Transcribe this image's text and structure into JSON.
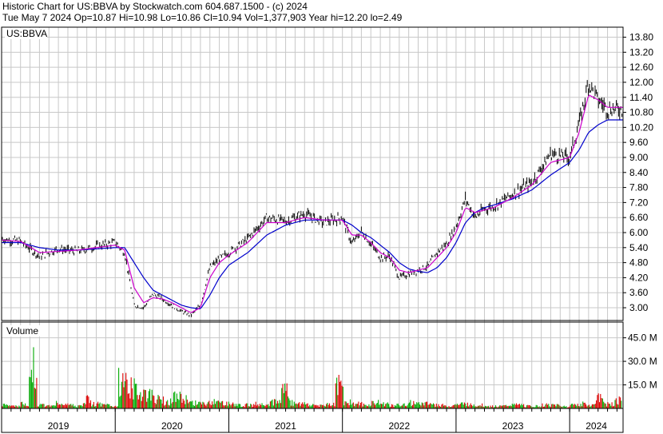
{
  "header": {
    "title_line": "Historic Chart for US:BBVA by Stockwatch.com 604.687.1500 - (c) 2024",
    "quote_line": "Tue May  7 2024  Op=10.87  Hi=10.98  Lo=10.86  Cl=10.94  Vol=1,377,903  Year hi=12.20  lo=2.49"
  },
  "colors": {
    "up": "#00aa00",
    "down": "#dd0000",
    "ma_short": "#cc00cc",
    "ma_long": "#0000cc",
    "grid": "#c8c8c8",
    "price_bars": "#000000"
  },
  "chart_data": [
    {
      "type": "line",
      "panel": "price",
      "label": "US:BBVA",
      "ylim": [
        2.49,
        14.2
      ],
      "yticks": [
        "3.00",
        "3.60",
        "4.20",
        "4.80",
        "5.40",
        "6.00",
        "6.60",
        "7.20",
        "7.80",
        "8.40",
        "9.00",
        "9.60",
        "10.20",
        "10.80",
        "11.40",
        "12.00",
        "12.60",
        "13.20",
        "13.80"
      ],
      "x": [
        "2019-01",
        "2019-03",
        "2019-05",
        "2019-07",
        "2019-09",
        "2019-11",
        "2020-01",
        "2020-02",
        "2020-03",
        "2020-04",
        "2020-05",
        "2020-06",
        "2020-07",
        "2020-08",
        "2020-09",
        "2020-10",
        "2020-11",
        "2020-12",
        "2021-01",
        "2021-03",
        "2021-05",
        "2021-07",
        "2021-09",
        "2021-11",
        "2022-01",
        "2022-02",
        "2022-03",
        "2022-04",
        "2022-05",
        "2022-06",
        "2022-07",
        "2022-08",
        "2022-09",
        "2022-10",
        "2022-11",
        "2022-12",
        "2023-01",
        "2023-02",
        "2023-03",
        "2023-04",
        "2023-05",
        "2023-07",
        "2023-09",
        "2023-11",
        "2024-01",
        "2024-02",
        "2024-03",
        "2024-04",
        "2024-05"
      ],
      "series": [
        {
          "name": "",
          "role": "close",
          "values": [
            5.75,
            5.65,
            5.05,
            5.35,
            5.25,
            5.45,
            5.6,
            5.2,
            3.1,
            3.0,
            3.55,
            3.35,
            3.1,
            2.85,
            2.7,
            3.1,
            4.6,
            4.95,
            5.2,
            5.75,
            6.6,
            6.45,
            6.75,
            6.4,
            6.6,
            5.55,
            6.05,
            5.55,
            5.0,
            5.05,
            4.2,
            4.35,
            4.5,
            4.65,
            5.2,
            5.55,
            6.25,
            7.35,
            6.6,
            6.95,
            7.05,
            7.55,
            8.0,
            9.15,
            9.0,
            10.35,
            12.0,
            11.3,
            10.94
          ]
        },
        {
          "name": "",
          "role": "ma-short",
          "values": [
            5.7,
            5.65,
            5.2,
            5.25,
            5.3,
            5.4,
            5.5,
            5.3,
            3.8,
            3.2,
            3.4,
            3.35,
            3.2,
            3.0,
            2.8,
            3.0,
            4.2,
            4.8,
            5.1,
            5.6,
            6.4,
            6.4,
            6.6,
            6.5,
            6.5,
            5.9,
            5.9,
            5.6,
            5.2,
            5.0,
            4.5,
            4.4,
            4.5,
            4.6,
            5.0,
            5.4,
            6.0,
            7.0,
            6.8,
            6.9,
            7.0,
            7.4,
            7.9,
            8.8,
            9.0,
            10.0,
            11.5,
            11.3,
            11.0
          ]
        },
        {
          "name": "",
          "role": "ma-long",
          "values": [
            5.6,
            5.6,
            5.4,
            5.3,
            5.3,
            5.35,
            5.4,
            5.4,
            4.8,
            4.2,
            3.7,
            3.5,
            3.3,
            3.1,
            3.0,
            2.95,
            3.5,
            4.2,
            4.7,
            5.2,
            5.9,
            6.3,
            6.5,
            6.5,
            6.5,
            6.3,
            6.0,
            5.8,
            5.5,
            5.2,
            4.8,
            4.55,
            4.45,
            4.4,
            4.6,
            5.0,
            5.6,
            6.4,
            6.8,
            7.0,
            7.1,
            7.35,
            7.7,
            8.3,
            8.8,
            9.3,
            10.0,
            10.3,
            10.5
          ]
        }
      ]
    },
    {
      "type": "bar",
      "panel": "volume",
      "label": "Volume",
      "ylim": [
        0,
        55
      ],
      "yticks": [
        "15.0 M",
        "30.0 M",
        "45.0 M"
      ],
      "xticks": [
        "2019",
        "2020",
        "2021",
        "2022",
        "2023",
        "2024"
      ],
      "values_m": [
        3,
        2,
        4,
        38,
        3,
        2,
        5,
        3,
        2,
        8,
        4,
        3,
        2,
        24,
        18,
        14,
        12,
        8,
        6,
        10,
        8,
        5,
        4,
        6,
        5,
        4,
        3,
        3,
        4,
        5,
        6,
        18,
        5,
        4,
        3,
        3,
        4,
        20,
        6,
        4,
        3,
        5,
        4,
        3,
        3,
        5,
        4,
        4,
        3,
        2,
        3,
        4,
        3,
        3,
        2,
        2,
        3,
        3,
        2,
        2,
        3,
        3,
        2,
        3,
        4,
        3,
        9,
        4,
        7
      ]
    }
  ]
}
